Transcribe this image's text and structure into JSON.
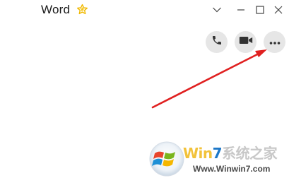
{
  "title_bar": {
    "title": "Word",
    "favorite_icon": "star-icon",
    "window_controls": [
      {
        "name": "dropdown",
        "icon": "chevron-down-icon"
      },
      {
        "name": "minimize",
        "icon": "minimize-icon"
      },
      {
        "name": "maximize",
        "icon": "maximize-icon"
      },
      {
        "name": "close",
        "icon": "close-icon"
      }
    ]
  },
  "chat_actions": [
    {
      "name": "voice-call",
      "icon": "phone-icon"
    },
    {
      "name": "video-call",
      "icon": "video-camera-icon"
    },
    {
      "name": "more",
      "icon": "more-dots-icon"
    }
  ],
  "annotation": {
    "type": "arrow",
    "color": "#e02020",
    "points_to": "more"
  },
  "watermark": {
    "brand_part1": "Win",
    "brand_part2": "7",
    "brand_part3": "系统之家",
    "url": "Www.Winwin7.com"
  },
  "colors": {
    "star": "#f5c518",
    "icon": "#333333",
    "button_bg": "#e6e6e6",
    "arrow": "#e02020"
  }
}
